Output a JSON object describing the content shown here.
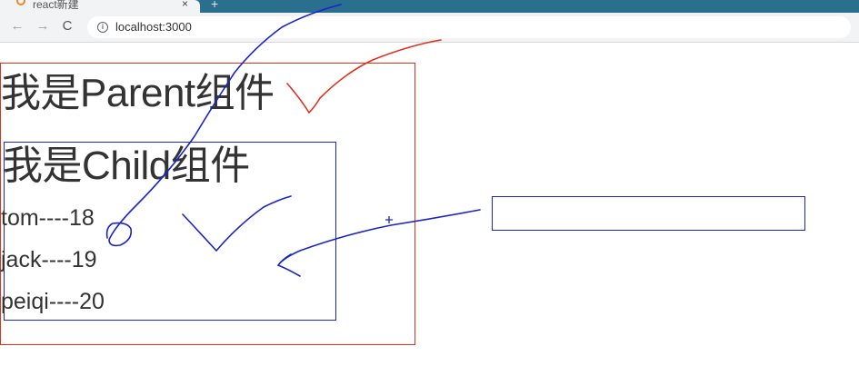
{
  "browser": {
    "tab_title": "react新建",
    "tab_close": "×",
    "new_tab": "+",
    "nav": {
      "back": "←",
      "forward": "→",
      "reload": "C"
    },
    "url": "localhost:3000"
  },
  "page": {
    "parent_title": "我是Parent组件",
    "child_title": "我是Child组件",
    "persons": [
      "tom----18",
      "jack----19",
      "peiqi----20"
    ],
    "input_value": ""
  },
  "annotation_colors": {
    "parent_border": "#e0301e",
    "child_border": "#1b24c7",
    "pen_blue": "#1b24c7",
    "pen_red": "#e0301e"
  }
}
